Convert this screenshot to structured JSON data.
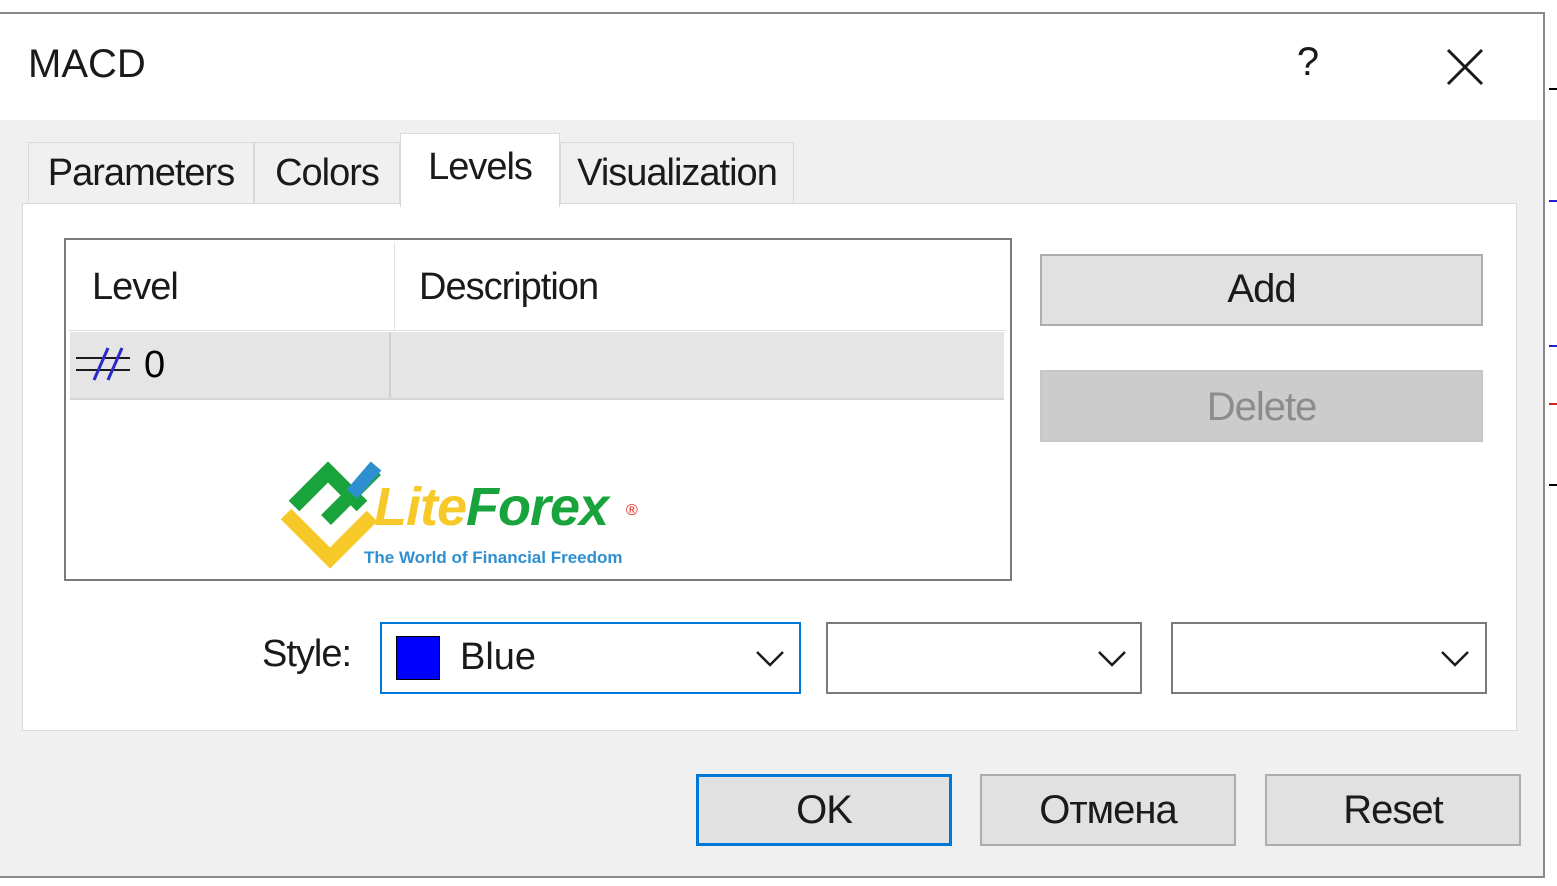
{
  "window": {
    "title": "MACD",
    "help_label": "?",
    "close_icon": "close-icon"
  },
  "tabs": [
    {
      "label": "Parameters",
      "active": false
    },
    {
      "label": "Colors",
      "active": false
    },
    {
      "label": "Levels",
      "active": true
    },
    {
      "label": "Visualization",
      "active": false
    }
  ],
  "levels_list": {
    "columns": [
      "Level",
      "Description"
    ],
    "rows": [
      {
        "icon": "level-line-icon",
        "level": "0",
        "description": ""
      }
    ]
  },
  "actions": {
    "add_label": "Add",
    "delete_label": "Delete",
    "delete_enabled": false
  },
  "style": {
    "label": "Style:",
    "color_name": "Blue",
    "color_hex": "#0000ff",
    "line_style": "dashed",
    "line_width": "thin solid"
  },
  "logo": {
    "brand_part1": "Lite",
    "brand_part2": "Forex",
    "registered": "®",
    "tagline": "The World of Financial Freedom"
  },
  "footer": {
    "ok_label": "OK",
    "cancel_label": "Отмена",
    "reset_label": "Reset"
  },
  "colors": {
    "accent": "#0078d7",
    "logo_green": "#18a33c",
    "logo_yellow": "#f7c928",
    "logo_blue": "#2e8fd0"
  }
}
